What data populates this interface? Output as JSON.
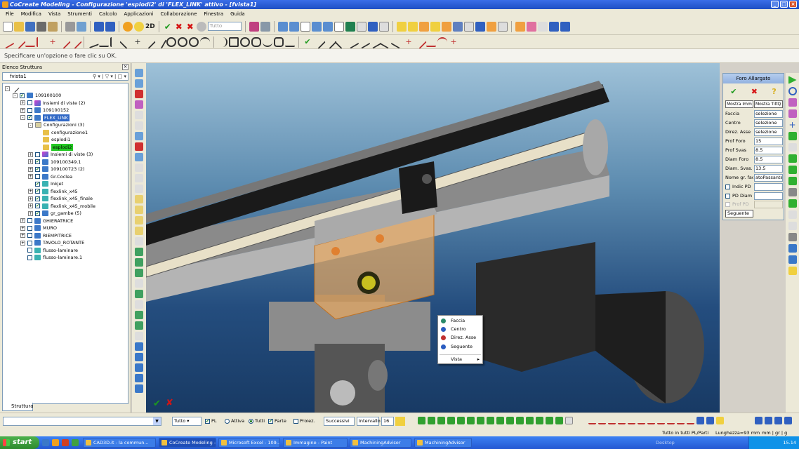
{
  "window": {
    "title": "CoCreate Modeling - Configurazione 'esplodi2' di 'FLEX_LINK' attivo - [fvista1]"
  },
  "menu": [
    "File",
    "Modifica",
    "Vista",
    "Strumenti",
    "Calcolo",
    "Applicazioni",
    "Collaborazione",
    "Finestra",
    "Guida"
  ],
  "toolbar": {
    "view_label": "2D",
    "filter_value": "Tutto"
  },
  "prompt": "Specificare un'opzione o fare clic su OK.",
  "structure": {
    "title": "Elenco Struttura",
    "view_name": "fvista1",
    "tab_label": "Struttura",
    "tree": [
      {
        "label": "109100100",
        "depth": 1,
        "type": "part",
        "exp": "-",
        "checked": true
      },
      {
        "label": "Insiemi di viste (2)",
        "depth": 2,
        "type": "asm",
        "exp": "+",
        "checked": false
      },
      {
        "label": "109100152",
        "depth": 2,
        "type": "part",
        "exp": "+",
        "checked": false
      },
      {
        "label": "FLEX_LINK",
        "depth": 2,
        "type": "part",
        "exp": "-",
        "checked": true,
        "highlight": "blue"
      },
      {
        "label": "Configurazioni (3)",
        "depth": 3,
        "type": "folder",
        "exp": "-",
        "checked": null
      },
      {
        "label": "configurazione1",
        "depth": 4,
        "type": "cfg",
        "exp": "",
        "checked": null
      },
      {
        "label": "esplodi1",
        "depth": 4,
        "type": "cfg",
        "exp": "",
        "checked": null
      },
      {
        "label": "esplodi2",
        "depth": 4,
        "type": "cfg",
        "exp": "",
        "checked": null,
        "highlight": "green"
      },
      {
        "label": "Insiemi di viste (3)",
        "depth": 3,
        "type": "asm",
        "exp": "+",
        "checked": false
      },
      {
        "label": "109100349.1",
        "depth": 3,
        "type": "part",
        "exp": "+",
        "checked": true
      },
      {
        "label": "109100723 (2)",
        "depth": 3,
        "type": "part",
        "exp": "+",
        "checked": true
      },
      {
        "label": "Gr.Coclea",
        "depth": 3,
        "type": "part",
        "exp": "+",
        "checked": false
      },
      {
        "label": "Inkjet",
        "depth": 3,
        "type": "flow",
        "exp": "",
        "checked": true
      },
      {
        "label": "flexlink_x45",
        "depth": 3,
        "type": "flow",
        "exp": "+",
        "checked": true
      },
      {
        "label": "flexlink_x45_finale",
        "depth": 3,
        "type": "flow",
        "exp": "+",
        "checked": true
      },
      {
        "label": "flexlink_x45_mobile",
        "depth": 3,
        "type": "flow",
        "exp": "+",
        "checked": true
      },
      {
        "label": "gr_gambe (5)",
        "depth": 3,
        "type": "part",
        "exp": "+",
        "checked": true
      },
      {
        "label": "GHIERATRICE",
        "depth": 2,
        "type": "part",
        "exp": "+",
        "checked": false
      },
      {
        "label": "MURO",
        "depth": 2,
        "type": "part",
        "exp": "+",
        "checked": false
      },
      {
        "label": "RIEMPITRICE",
        "depth": 2,
        "type": "part",
        "exp": "+",
        "checked": false
      },
      {
        "label": "TAVOLO_ROTANTE",
        "depth": 2,
        "type": "part",
        "exp": "+",
        "checked": false
      },
      {
        "label": "flusso-laminare",
        "depth": 2,
        "type": "flow",
        "exp": "",
        "checked": false
      },
      {
        "label": "flusso-laminare.1",
        "depth": 2,
        "type": "flow",
        "exp": "",
        "checked": false
      }
    ]
  },
  "context_menu": {
    "items": [
      {
        "label": "Faccia",
        "icon": "face-icon",
        "color": "#2a8a6a"
      },
      {
        "label": "Centro",
        "icon": "center-icon",
        "color": "#2a5cc0"
      },
      {
        "label": "Direz. Asse",
        "icon": "axis-icon",
        "color": "#c03030"
      },
      {
        "label": "Seguente",
        "icon": "next-icon",
        "color": "#2a5cc0"
      },
      {
        "label": "Vista",
        "icon": "",
        "color": ""
      }
    ]
  },
  "foro": {
    "title": "Foro Allargato",
    "header_left": "Mostra Imm",
    "header_right": "Mostra TiltQ",
    "rows": [
      {
        "label": "Faccia",
        "value": "selezione"
      },
      {
        "label": "Centro",
        "value": "selezione"
      },
      {
        "label": "Direz. Asse",
        "value": "selezione"
      },
      {
        "label": "Prof Foro",
        "value": "15"
      },
      {
        "label": "Prof Svas",
        "value": "8.5"
      },
      {
        "label": "Diam Foro",
        "value": "8.5"
      },
      {
        "label": "Diam. Svas.",
        "value": "13.5"
      },
      {
        "label": "Nome gr. fac",
        "value": "atoPassante"
      }
    ],
    "checks": [
      {
        "label": "Indic PD",
        "enabled": true
      },
      {
        "label": "PD Diam",
        "enabled": true
      },
      {
        "label": "Prof PD",
        "enabled": false
      }
    ],
    "next": "Seguente"
  },
  "bottom": {
    "filter": "Tutto",
    "pl": "PL",
    "attiva": "Attiva",
    "tutti": "Tutti",
    "parte": "Parte",
    "proiez": "Proiez.",
    "successivi": "Successivi",
    "intervallo": "Intervallo",
    "count": "16"
  },
  "status": {
    "mode": "Tutto in tutti PL/Parti",
    "length": "Lunghezza=93 mm",
    "units": "mm | gr | g"
  },
  "taskbar": {
    "start": "start",
    "tasks": [
      "CAD3D.it - la commun...",
      "CoCreate Modeling - ...",
      "Microsoft Excel - 109...",
      "Immagine - Paint",
      "MachiningAdvisor",
      "MachiningAdvisor"
    ],
    "desktop": "Desktop",
    "clock": "15.14"
  }
}
